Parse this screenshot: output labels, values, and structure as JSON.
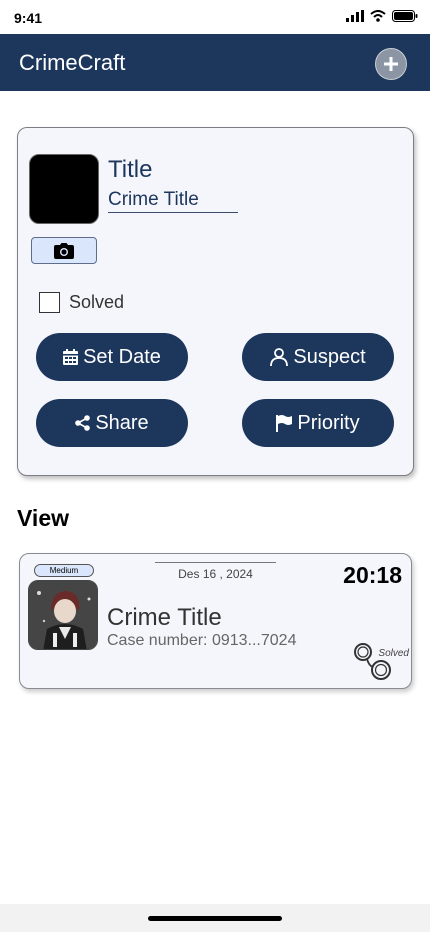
{
  "status_bar": {
    "time": "9:41",
    "icons": [
      "signal-icon",
      "wifi-icon",
      "battery-icon"
    ]
  },
  "app_bar": {
    "title": "CrimeCraft",
    "add_icon": "plus-icon",
    "color": "#1d365c"
  },
  "form": {
    "title_label": "Title",
    "title_value": "Crime Title",
    "camera_icon": "camera-icon",
    "solved_label": "Solved",
    "solved_checked": false,
    "buttons": {
      "set_date": "Set Date",
      "suspect": "Suspect",
      "share": "Share",
      "priority": "Priority"
    }
  },
  "section_title": "View",
  "crime_card": {
    "priority": "Medium",
    "date": "Des 16 , 2024",
    "time": "20:18",
    "title": "Crime Title",
    "case_number": "Case number: 0913...7024",
    "status": "Solved",
    "status_icon": "handcuffs-icon"
  },
  "colors": {
    "primary": "#1d365c",
    "card_bg": "#f5f5fc",
    "badge_bg": "#d9e6fb"
  }
}
